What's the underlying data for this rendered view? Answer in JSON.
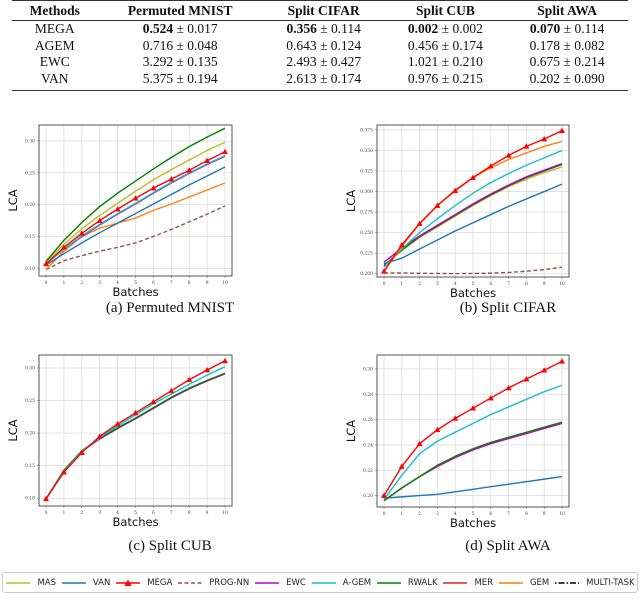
{
  "table": {
    "headers": [
      "Methods",
      "Permuted MNIST",
      "Split CIFAR",
      "Split CUB",
      "Split AWA"
    ],
    "rows": [
      {
        "method": "MEGA",
        "cells": [
          {
            "mean": "0.524",
            "std": "0.017",
            "bold": true
          },
          {
            "mean": "0.356",
            "std": "0.114",
            "bold": true
          },
          {
            "mean": "0.002",
            "std": "0.002",
            "bold": true
          },
          {
            "mean": "0.070",
            "std": "0.114",
            "bold": true
          }
        ]
      },
      {
        "method": "AGEM",
        "cells": [
          {
            "mean": "0.716",
            "std": "0.048"
          },
          {
            "mean": "0.643",
            "std": "0.124"
          },
          {
            "mean": "0.456",
            "std": "0.174"
          },
          {
            "mean": "0.178",
            "std": "0.082"
          }
        ]
      },
      {
        "method": "EWC",
        "cells": [
          {
            "mean": "3.292",
            "std": "0.135"
          },
          {
            "mean": "2.493",
            "std": "0.427"
          },
          {
            "mean": "1.021",
            "std": "0.210"
          },
          {
            "mean": "0.675",
            "std": "0.214"
          }
        ]
      },
      {
        "method": "VAN",
        "cells": [
          {
            "mean": "5.375",
            "std": "0.194"
          },
          {
            "mean": "2.613",
            "std": "0.174"
          },
          {
            "mean": "0.976",
            "std": "0.215"
          },
          {
            "mean": "0.202",
            "std": "0.090"
          }
        ]
      }
    ],
    "pm_symbol": "±"
  },
  "styles": {
    "MAS": {
      "color": "#bcbd22",
      "dash": "",
      "marker": false
    },
    "VAN": {
      "color": "#1f77b4",
      "dash": "",
      "marker": false
    },
    "MEGA": {
      "color": "#ff0000",
      "dash": "",
      "marker": true
    },
    "PROG-NN": {
      "color": "#8c564b",
      "dash": "4,2.5",
      "marker": false
    },
    "EWC": {
      "color": "#c000c0",
      "dash": "",
      "marker": false
    },
    "A-GEM": {
      "color": "#17becf",
      "dash": "",
      "marker": false
    },
    "RWALK": {
      "color": "#008000",
      "dash": "",
      "marker": false
    },
    "MER": {
      "color": "#d62728",
      "dash": "",
      "marker": false
    },
    "GEM": {
      "color": "#ff7f0e",
      "dash": "",
      "marker": false
    },
    "MULTI-TASK": {
      "color": "#000000",
      "dash": "1.5,2,6,2",
      "marker": false
    }
  },
  "legend": [
    "MAS",
    "VAN",
    "MEGA",
    "PROG-NN",
    "EWC",
    "A-GEM",
    "RWALK",
    "MER",
    "GEM",
    "MULTI-TASK"
  ],
  "chart_data": [
    {
      "type": "line",
      "caption": "(a) Permuted MNIST",
      "xlabel": "Batches",
      "ylabel": "LCA",
      "x": [
        0,
        1,
        2,
        3,
        4,
        5,
        6,
        7,
        8,
        9,
        10
      ],
      "xticks": [
        "0",
        "1",
        "2",
        "3",
        "4",
        "5",
        "6",
        "7",
        "8",
        "9",
        "10"
      ],
      "ylim": [
        0.088,
        0.325
      ],
      "yticks": [
        0.1,
        0.15,
        0.2,
        0.25,
        0.3
      ],
      "ytick_labels": [
        "0.10",
        "0.15",
        "0.20",
        "0.25",
        "0.30"
      ],
      "grid": true,
      "series": [
        {
          "name": "PROG-NN",
          "values": [
            0.098,
            0.112,
            0.12,
            0.127,
            0.133,
            0.14,
            0.15,
            0.161,
            0.173,
            0.185,
            0.198
          ]
        },
        {
          "name": "GEM",
          "values": [
            0.098,
            0.127,
            0.15,
            0.163,
            0.171,
            0.179,
            0.191,
            0.201,
            0.212,
            0.223,
            0.234
          ]
        },
        {
          "name": "VAN",
          "values": [
            0.105,
            0.123,
            0.14,
            0.156,
            0.171,
            0.186,
            0.201,
            0.216,
            0.231,
            0.245,
            0.259
          ]
        },
        {
          "name": "EWC",
          "values": [
            0.107,
            0.13,
            0.15,
            0.168,
            0.185,
            0.201,
            0.218,
            0.234,
            0.249,
            0.263,
            0.276
          ]
        },
        {
          "name": "A-GEM",
          "values": [
            0.107,
            0.13,
            0.151,
            0.169,
            0.186,
            0.202,
            0.219,
            0.235,
            0.25,
            0.264,
            0.277
          ]
        },
        {
          "name": "MAS",
          "values": [
            0.11,
            0.138,
            0.162,
            0.183,
            0.202,
            0.221,
            0.239,
            0.255,
            0.27,
            0.285,
            0.298
          ]
        },
        {
          "name": "RWALK",
          "values": [
            0.111,
            0.144,
            0.172,
            0.197,
            0.218,
            0.237,
            0.256,
            0.274,
            0.291,
            0.306,
            0.32
          ]
        },
        {
          "name": "MEGA",
          "values": [
            0.107,
            0.133,
            0.155,
            0.175,
            0.193,
            0.21,
            0.226,
            0.24,
            0.254,
            0.269,
            0.283
          ]
        }
      ]
    },
    {
      "type": "line",
      "caption": "(b) Split CIFAR",
      "xlabel": "Batches",
      "ylabel": "LCA",
      "x": [
        0,
        1,
        2,
        3,
        4,
        5,
        6,
        7,
        8,
        9,
        10
      ],
      "xticks": [
        "0",
        "1",
        "2",
        "3",
        "4",
        "5",
        "6",
        "7",
        "8",
        "9",
        "10"
      ],
      "ylim": [
        0.196,
        0.381
      ],
      "yticks": [
        0.2,
        0.225,
        0.25,
        0.275,
        0.3,
        0.325,
        0.35,
        0.375
      ],
      "ytick_labels": [
        "0.200",
        "0.225",
        "0.250",
        "0.275",
        "0.300",
        "0.325",
        "0.350",
        "0.375"
      ],
      "grid": true,
      "series": [
        {
          "name": "PROG-NN",
          "values": [
            0.201,
            0.201,
            0.2005,
            0.2003,
            0.2002,
            0.2003,
            0.2008,
            0.2015,
            0.203,
            0.205,
            0.208
          ]
        },
        {
          "name": "VAN",
          "values": [
            0.212,
            0.219,
            0.23,
            0.241,
            0.252,
            0.262,
            0.272,
            0.282,
            0.291,
            0.3,
            0.309
          ]
        },
        {
          "name": "MAS",
          "values": [
            0.21,
            0.228,
            0.244,
            0.257,
            0.27,
            0.283,
            0.295,
            0.306,
            0.315,
            0.323,
            0.33
          ]
        },
        {
          "name": "RWALK",
          "values": [
            0.21,
            0.229,
            0.245,
            0.258,
            0.271,
            0.284,
            0.296,
            0.307,
            0.317,
            0.325,
            0.333
          ]
        },
        {
          "name": "EWC",
          "values": [
            0.214,
            0.231,
            0.246,
            0.259,
            0.272,
            0.285,
            0.297,
            0.308,
            0.318,
            0.326,
            0.334
          ]
        },
        {
          "name": "A-GEM",
          "values": [
            0.208,
            0.23,
            0.25,
            0.267,
            0.283,
            0.298,
            0.311,
            0.322,
            0.332,
            0.341,
            0.35
          ]
        },
        {
          "name": "GEM",
          "values": [
            0.203,
            0.233,
            0.261,
            0.283,
            0.302,
            0.317,
            0.329,
            0.339,
            0.347,
            0.355,
            0.361
          ]
        },
        {
          "name": "MEGA",
          "values": [
            0.203,
            0.235,
            0.261,
            0.283,
            0.301,
            0.317,
            0.331,
            0.344,
            0.355,
            0.364,
            0.374
          ]
        }
      ]
    },
    {
      "type": "line",
      "caption": "(c) Split CUB",
      "xlabel": "Batches",
      "ylabel": "LCA",
      "x": [
        0,
        1,
        2,
        3,
        4,
        5,
        6,
        7,
        8,
        9,
        10
      ],
      "xticks": [
        "0",
        "1",
        "2",
        "3",
        "4",
        "5",
        "6",
        "7",
        "8",
        "9",
        "10"
      ],
      "ylim": [
        0.088,
        0.32
      ],
      "yticks": [
        0.1,
        0.15,
        0.2,
        0.25,
        0.3
      ],
      "ytick_labels": [
        "0.10",
        "0.15",
        "0.20",
        "0.25",
        "0.30"
      ],
      "grid": true,
      "series": [
        {
          "name": "EWC",
          "values": [
            0.099,
            0.142,
            0.172,
            0.191,
            0.207,
            0.222,
            0.238,
            0.254,
            0.268,
            0.28,
            0.291
          ]
        },
        {
          "name": "RWALK",
          "values": [
            0.099,
            0.143,
            0.173,
            0.192,
            0.208,
            0.223,
            0.239,
            0.255,
            0.269,
            0.281,
            0.292
          ]
        },
        {
          "name": "A-GEM",
          "values": [
            0.099,
            0.141,
            0.172,
            0.193,
            0.211,
            0.228,
            0.245,
            0.26,
            0.275,
            0.289,
            0.302
          ]
        },
        {
          "name": "MEGA",
          "values": [
            0.099,
            0.14,
            0.17,
            0.195,
            0.214,
            0.231,
            0.248,
            0.265,
            0.282,
            0.297,
            0.311
          ]
        }
      ]
    },
    {
      "type": "line",
      "caption": "(d) Split AWA",
      "xlabel": "Batches",
      "ylabel": "LCA",
      "x": [
        0,
        1,
        2,
        3,
        4,
        5,
        6,
        7,
        8,
        9,
        10
      ],
      "xticks": [
        "0",
        "1",
        "2",
        "3",
        "4",
        "5",
        "6",
        "7",
        "8",
        "9",
        "10"
      ],
      "ylim": [
        0.191,
        0.311
      ],
      "yticks": [
        0.2,
        0.22,
        0.24,
        0.26,
        0.28,
        0.3
      ],
      "ytick_labels": [
        "0.20",
        "0.22",
        "0.24",
        "0.26",
        "0.28",
        "0.30"
      ],
      "grid": true,
      "series": [
        {
          "name": "VAN",
          "values": [
            0.198,
            0.199,
            0.2,
            0.201,
            0.203,
            0.205,
            0.207,
            0.209,
            0.211,
            0.213,
            0.215
          ]
        },
        {
          "name": "EWC",
          "values": [
            0.196,
            0.206,
            0.215,
            0.223,
            0.23,
            0.236,
            0.241,
            0.245,
            0.249,
            0.253,
            0.257
          ]
        },
        {
          "name": "RWALK",
          "values": [
            0.196,
            0.206,
            0.215,
            0.224,
            0.231,
            0.237,
            0.242,
            0.246,
            0.25,
            0.254,
            0.258
          ]
        },
        {
          "name": "A-GEM",
          "values": [
            0.197,
            0.216,
            0.233,
            0.243,
            0.25,
            0.257,
            0.264,
            0.27,
            0.276,
            0.282,
            0.287
          ]
        },
        {
          "name": "MEGA",
          "values": [
            0.2,
            0.223,
            0.241,
            0.252,
            0.261,
            0.269,
            0.277,
            0.285,
            0.292,
            0.299,
            0.306
          ]
        }
      ]
    }
  ]
}
